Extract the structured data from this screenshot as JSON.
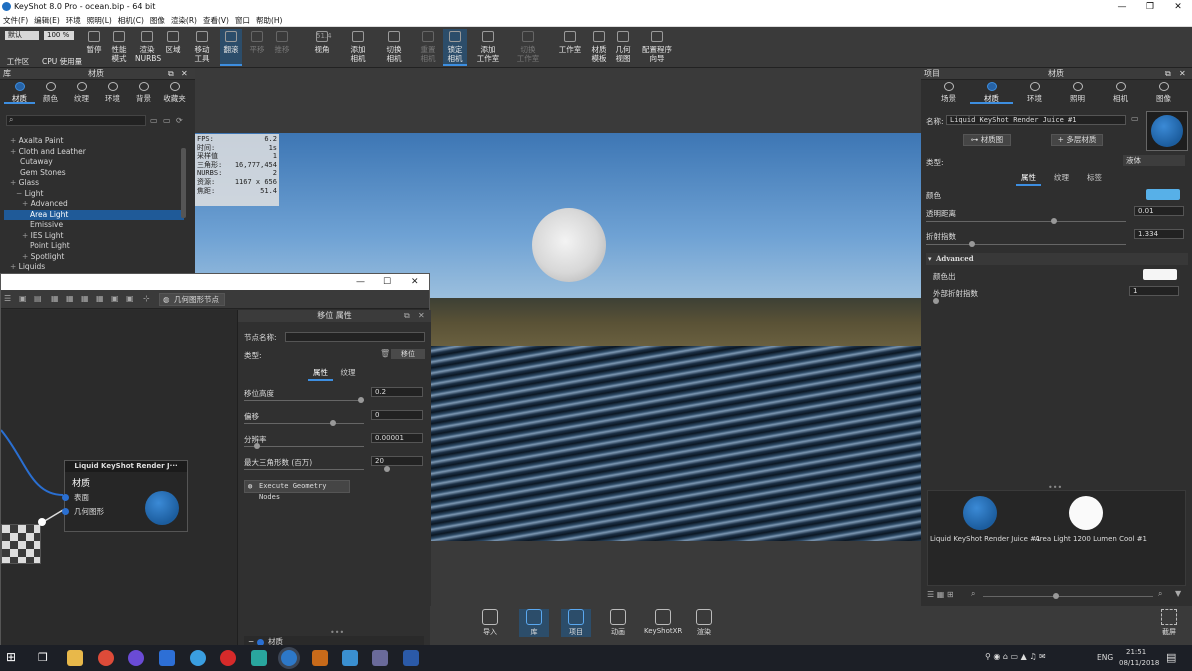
{
  "window": {
    "title": "KeyShot 8.0 Pro  -  ocean.bip  -  64 bit"
  },
  "menu": [
    "文件(F)",
    "编辑(E)",
    "环境",
    "照明(L)",
    "相机(C)",
    "图像",
    "渲染(R)",
    "查看(V)",
    "窗口",
    "帮助(H)"
  ],
  "toolbar": {
    "preset": "默认",
    "zoom": "100 %",
    "items": [
      {
        "label": "工作区",
        "name": "workspace"
      },
      {
        "label": "CPU 使用量",
        "name": "cpu-usage"
      },
      {
        "label": "暂停",
        "name": "pause"
      },
      {
        "label": "性能\n模式",
        "name": "perf-mode"
      },
      {
        "label": "渲染\nNURBS",
        "name": "render-nurbs"
      },
      {
        "label": "区域",
        "name": "region"
      },
      {
        "label": "移动\n工具",
        "name": "move-tool"
      },
      {
        "label": "翻滚",
        "name": "tumble"
      },
      {
        "label": "平移",
        "name": "pan"
      },
      {
        "label": "推移",
        "name": "dolly"
      },
      {
        "label": "视角",
        "name": "perspective"
      },
      {
        "label": "添加\n相机",
        "name": "add-camera"
      },
      {
        "label": "切换\n相机",
        "name": "switch-camera"
      },
      {
        "label": "重置\n相机",
        "name": "reset-camera"
      },
      {
        "label": "锁定\n相机",
        "name": "lock-camera"
      },
      {
        "label": "添加\n工作室",
        "name": "add-studio"
      },
      {
        "label": "切换\n工作室",
        "name": "switch-studio"
      },
      {
        "label": "工作室",
        "name": "studio"
      },
      {
        "label": "材质\n模板",
        "name": "material-template"
      },
      {
        "label": "几何\n视图",
        "name": "geometry-view"
      },
      {
        "label": "配置程序\n向导",
        "name": "configurator-wizard"
      }
    ],
    "fov": "51.4"
  },
  "library": {
    "title": "材质",
    "panel_label": "库",
    "tabs": [
      "材质",
      "颜色",
      "纹理",
      "环境",
      "背景",
      "收藏夹"
    ],
    "tree": [
      "Axalta Paint",
      "Cloth and Leather",
      "Cutaway",
      "Gem Stones",
      "Glass",
      "Light",
      "Advanced",
      "Area Light",
      "Emissive",
      "IES Light",
      "Point Light",
      "Spotlight",
      "Liquids"
    ]
  },
  "stats": {
    "rows": [
      [
        "FPS:",
        "6.2"
      ],
      [
        "时间:",
        "1s"
      ],
      [
        "采样值",
        "1"
      ],
      [
        "三角形:",
        "16,777,454"
      ],
      [
        "NURBS:",
        "2"
      ],
      [
        "资源:",
        "1167 x 656"
      ],
      [
        "焦距:",
        "51.4"
      ]
    ]
  },
  "nodewin": {
    "toolbar_btn": "几何图形节点",
    "node_title": "Liquid KeyShot Render J···",
    "node_body": "材质",
    "port1": "表面",
    "port2": "几何图形",
    "props_title": "移位 属性",
    "node_name_label": "节点名称:",
    "type_label": "类型:",
    "type_value": "移位",
    "tab1": "属性",
    "tab2": "纹理",
    "fields": [
      {
        "label": "移位高度",
        "value": "0.2"
      },
      {
        "label": "偏移",
        "value": "0"
      },
      {
        "label": "分辨率",
        "value": "0.00001"
      },
      {
        "label": "最大三角形数 (百万)",
        "value": "20"
      }
    ],
    "exec_btn": "Execute Geometry Nodes",
    "footer": "材质"
  },
  "project": {
    "title": "材质",
    "panel_label": "项目",
    "tabs": [
      "场景",
      "材质",
      "环境",
      "照明",
      "相机",
      "图像"
    ],
    "name_label": "名称:",
    "name_value": "Liquid KeyShot Render Juice #1",
    "btn_graph": "材质图",
    "btn_multi": "多层材质",
    "type_label": "类型:",
    "type_value": "液体",
    "subtabs": [
      "属性",
      "纹理",
      "标签"
    ],
    "color_label": "颜色",
    "transparency_label": "透明距离",
    "transparency_value": "0.01",
    "ior_label": "折射指数",
    "ior_value": "1.334",
    "advanced": "Advanced",
    "color_out_label": "颜色出",
    "outer_ior_label": "外部折射指数",
    "outer_ior_value": "1",
    "thumbs": [
      "Liquid KeyShot Render Juice #1",
      "Area Light 1200 Lumen Cool #1"
    ],
    "accent": "#1e6fb8"
  },
  "bottom": {
    "items": [
      "导入",
      "库",
      "项目",
      "动画",
      "KeyShotXR",
      "渲染"
    ],
    "screenshot": "截屏"
  },
  "taskbar": {
    "lang": "ENG",
    "time": "21:51",
    "date": "08/11/2018"
  }
}
